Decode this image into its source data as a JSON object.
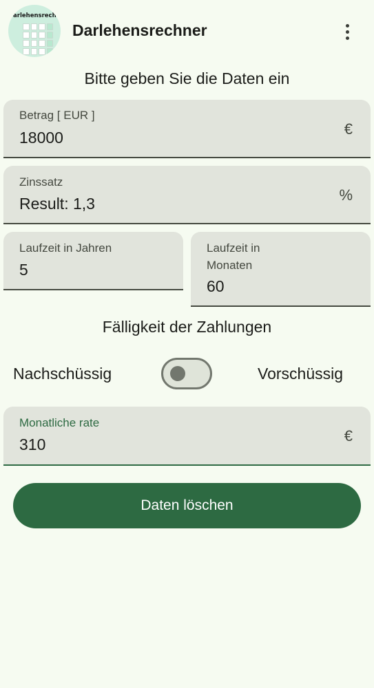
{
  "app_bar": {
    "title": "Darlehensrechner",
    "logo_text": "Darlehensrechner",
    "menu_icon": "more-vert-icon"
  },
  "form": {
    "heading": "Bitte geben Sie die Daten ein",
    "amount": {
      "label": "Betrag [ EUR ]",
      "value": "18000",
      "suffix": "€"
    },
    "interest": {
      "label": "Zinssatz",
      "value": "Result: 1,3",
      "suffix": "%"
    },
    "term_years": {
      "label": "Laufzeit in Jahren",
      "value": "5"
    },
    "term_months": {
      "label_line1": "Laufzeit in",
      "label_line2": "Monaten",
      "value": "60"
    }
  },
  "payment": {
    "heading": "Fälligkeit der Zahlungen",
    "left_label": "Nachschüssig",
    "right_label": "Vorschüssig",
    "switch_on": false
  },
  "result": {
    "label": "Monatliche rate",
    "value": "310",
    "suffix": "€"
  },
  "actions": {
    "clear_label": "Daten löschen"
  },
  "colors": {
    "background": "#f6fbf1",
    "field": "#e1e4dc",
    "accent": "#2d6a42",
    "outline": "#72776e"
  }
}
